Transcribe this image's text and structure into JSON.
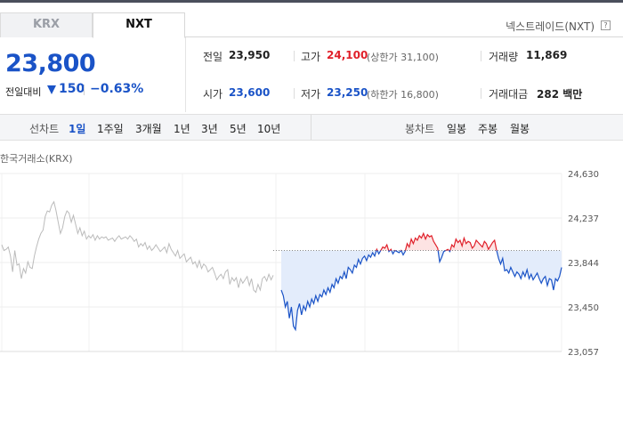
{
  "tabs": {
    "krx": "KRX",
    "nxt": "NXT"
  },
  "nxt_link": "넥스트레이드(NXT)",
  "help_icon": "?",
  "current_price": "23,800",
  "change": {
    "label": "전일대비",
    "amount": "150",
    "percent": "−0.63%",
    "direction": "down"
  },
  "stats": {
    "prev_close": {
      "label": "전일",
      "value": "23,950"
    },
    "high": {
      "label": "고가",
      "value": "24,100",
      "note": "(상한가 31,100)"
    },
    "volume": {
      "label": "거래량",
      "value": "11,869"
    },
    "open": {
      "label": "시가",
      "value": "23,600"
    },
    "low": {
      "label": "저가",
      "value": "23,250",
      "note": "(하한가 16,800)"
    },
    "amount": {
      "label": "거래대금",
      "value": "282 백만"
    }
  },
  "toolbar": {
    "line_label": "선차트",
    "periods": [
      "1일",
      "1주일",
      "3개월",
      "1년",
      "3년",
      "5년",
      "10년"
    ],
    "active_period": "1일",
    "candle_label": "봉차트",
    "candles": [
      "일봉",
      "주봉",
      "월봉"
    ]
  },
  "chart_caption": "한국거래소(KRX)",
  "colors": {
    "up": "#e0202a",
    "down": "#1a53c7",
    "krx_line": "#bbbbbb",
    "baseline": "#888888"
  },
  "chart_data": {
    "type": "line",
    "title": "",
    "ylabel": "",
    "y_ticks": [
      "24,630",
      "24,237",
      "23,844",
      "23,450",
      "23,057"
    ],
    "ylim": [
      23057,
      24630
    ],
    "baseline": 23950,
    "series": [
      {
        "values": [
          24000,
          23950,
          23960,
          23980,
          23900,
          23760,
          23950,
          23820,
          23830,
          23700,
          23790,
          23750,
          23850,
          23800,
          23790,
          23900,
          23980,
          24050,
          24100,
          24130,
          24250,
          24300,
          24290,
          24350,
          24380,
          24300,
          24200,
          24100,
          24150,
          24250,
          24300,
          24280,
          24200,
          24260,
          24180,
          24100,
          24150,
          24080,
          24120,
          24050,
          24080,
          24060,
          24090,
          24040,
          24080,
          24050,
          24070,
          24060,
          24070,
          24040,
          24050,
          24060,
          24030,
          24060,
          24080,
          24050,
          24060,
          24070,
          24050,
          24080,
          24060,
          24030,
          24050,
          23980,
          24010,
          23990,
          24020,
          23960,
          23990,
          23950,
          23970,
          24000,
          23970,
          23940,
          23960,
          23980,
          23930,
          24010,
          23960,
          23930,
          23900,
          23950,
          23880,
          23900,
          23920,
          23850,
          23870,
          23890,
          23830,
          23850,
          23800,
          23860,
          23790,
          23830,
          23810,
          23760,
          23780,
          23800,
          23750,
          23690,
          23720,
          23740,
          23700,
          23760,
          23780,
          23650,
          23710,
          23680,
          23710,
          23620,
          23700,
          23660,
          23690,
          23720,
          23640,
          23700,
          23600,
          23580,
          23650,
          23600,
          23700,
          23720,
          23680,
          23740,
          23690,
          23730
        ]
      },
      {
        "values": [
          23600,
          23550,
          23450,
          23500,
          23350,
          23450,
          23280,
          23250,
          23420,
          23480,
          23380,
          23460,
          23420,
          23500,
          23450,
          23520,
          23480,
          23550,
          23500,
          23560,
          23540,
          23600,
          23560,
          23620,
          23580,
          23650,
          23620,
          23700,
          23660,
          23720,
          23700,
          23760,
          23700,
          23800,
          23780,
          23750,
          23820,
          23800,
          23870,
          23830,
          23880,
          23900,
          23860,
          23910,
          23890,
          23930,
          23900,
          23960,
          23920,
          23950,
          23980,
          23970,
          24000,
          23940,
          23960,
          23920,
          23950,
          23940,
          23930,
          23950,
          23910,
          23940,
          24010,
          23980,
          24050,
          24010,
          24060,
          24040,
          24080,
          24060,
          24100,
          24050,
          24090,
          24070,
          24080,
          24030,
          24000,
          23970,
          23850,
          23890,
          23940,
          23950,
          23960,
          23940,
          24000,
          23980,
          24050,
          24020,
          24040,
          23990,
          24060,
          24010,
          24030,
          24020,
          23970,
          23990,
          24040,
          24020,
          24000,
          23980,
          24030,
          24010,
          23960,
          23990,
          24020,
          24040,
          23950,
          23880,
          23830,
          23880,
          23770,
          23780,
          23750,
          23800,
          23760,
          23720,
          23760,
          23740,
          23700,
          23760,
          23720,
          23780,
          23700,
          23740,
          23690,
          23720,
          23750,
          23700,
          23660,
          23700,
          23720,
          23640,
          23700,
          23690,
          23600,
          23700,
          23680,
          23720,
          23800
        ]
      }
    ]
  }
}
